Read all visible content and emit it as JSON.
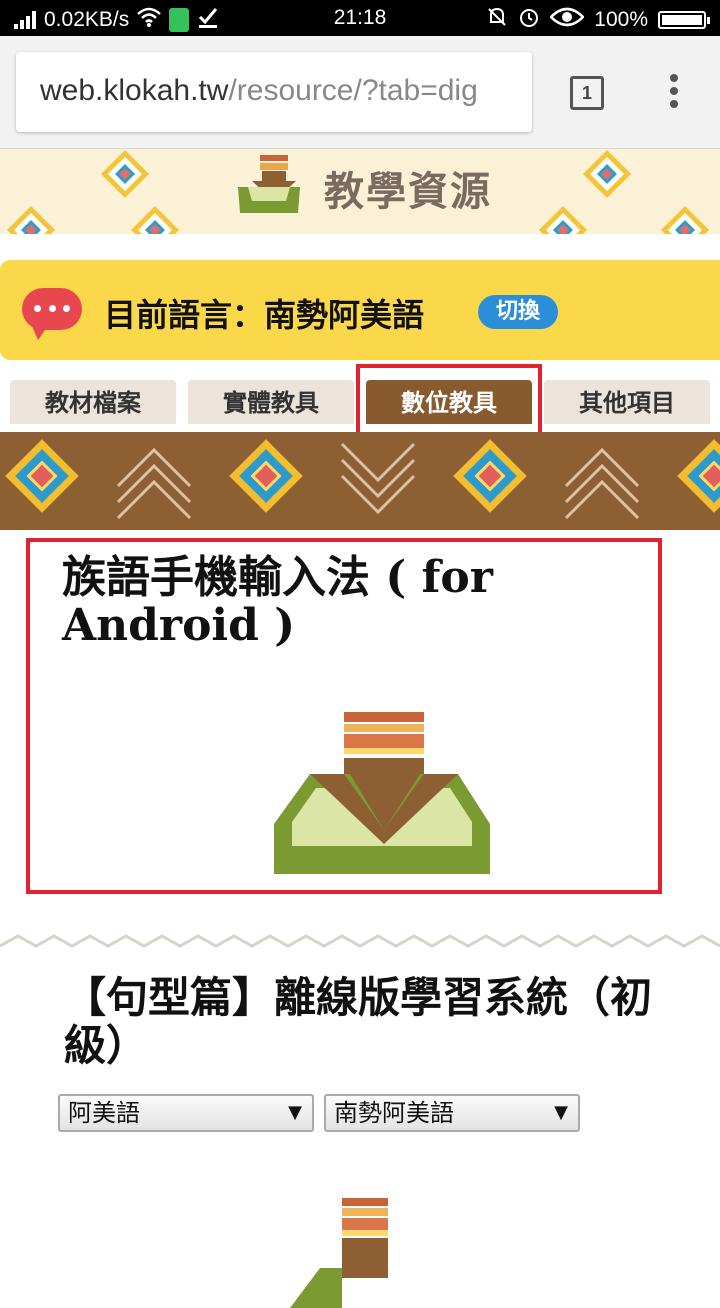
{
  "status_bar": {
    "speed": "0.02KB/s",
    "time": "21:18",
    "battery": "100%"
  },
  "browser": {
    "url_host": "web.klokah.tw",
    "url_path": "/resource/?tab=dig",
    "tab_count": "1"
  },
  "header": {
    "title": "教學資源"
  },
  "language_bar": {
    "label": "目前語言：南勢阿美語",
    "switch_label": "切換"
  },
  "tabs": [
    {
      "label": "教材檔案"
    },
    {
      "label": "實體教具"
    },
    {
      "label": "數位教具",
      "active": true
    },
    {
      "label": "其他項目"
    }
  ],
  "card1": {
    "title": "族語手機輸入法 ( for Android )"
  },
  "section2": {
    "title": "【句型篇】離線版學習系統（初級）",
    "select1": "阿美語",
    "select2": "南勢阿美語"
  },
  "colors": {
    "brown": "#8e5f33",
    "yellow": "#fad84a",
    "highlight_red": "#e0232f",
    "switch_blue": "#2a8fd8"
  }
}
